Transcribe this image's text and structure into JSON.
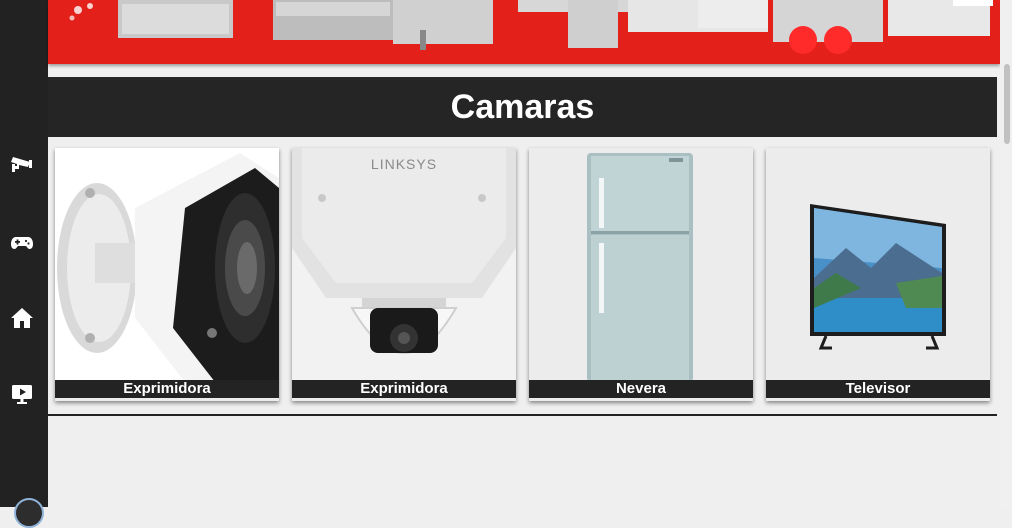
{
  "sidebar": {
    "items": [
      {
        "icon": "security-camera-icon"
      },
      {
        "icon": "gamepad-icon"
      },
      {
        "icon": "home-icon"
      },
      {
        "icon": "monitor-play-icon"
      }
    ]
  },
  "section": {
    "title": "Camaras"
  },
  "products": [
    {
      "name": "Exprimidora",
      "image": "bullet-camera"
    },
    {
      "name": "Exprimidora",
      "image": "dome-camera",
      "brand": "LINKSYS"
    },
    {
      "name": "Nevera",
      "image": "refrigerator"
    },
    {
      "name": "Televisor",
      "image": "television"
    }
  ],
  "colors": {
    "sidebar": "#222222",
    "title_bar": "#252525",
    "banner": "#e3211a",
    "background": "#efefef"
  }
}
